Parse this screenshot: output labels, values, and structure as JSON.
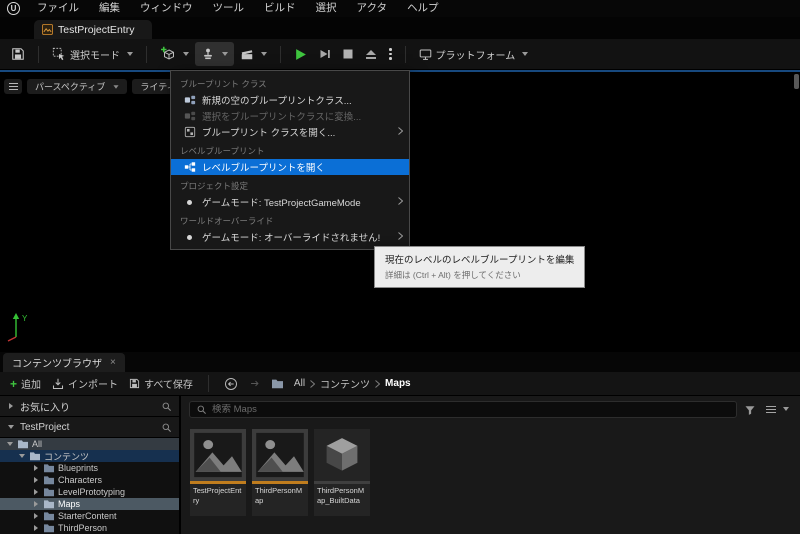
{
  "colors": {
    "accent_blue": "#0b6fd6",
    "accent_orange": "#c07d1e",
    "play_green": "#3fc43f",
    "selection_navy": "#16304f"
  },
  "menubar": {
    "items": [
      "ファイル",
      "編集",
      "ウィンドウ",
      "ツール",
      "ビルド",
      "選択",
      "アクタ",
      "ヘルプ"
    ]
  },
  "window_tab": {
    "label": "TestProjectEntry"
  },
  "toolbar": {
    "select_mode_label": "選択モード",
    "platform_label": "プラットフォーム"
  },
  "blueprint_menu": {
    "sections": [
      {
        "header": "ブループリント クラス",
        "items": [
          {
            "label": "新規の空のブループリントクラス...",
            "state": "normal",
            "submenu": false
          },
          {
            "label": "選択をブループリントクラスに変換...",
            "state": "disabled",
            "submenu": false
          },
          {
            "label": "ブループリント クラスを開く...",
            "state": "normal",
            "submenu": true
          }
        ]
      },
      {
        "header": "レベルブループリント",
        "items": [
          {
            "label": "レベルブループリントを開く",
            "state": "highlighted",
            "submenu": false
          }
        ]
      },
      {
        "header": "プロジェクト設定",
        "items": [
          {
            "label": "ゲームモード: TestProjectGameMode",
            "state": "normal",
            "submenu": true
          }
        ]
      },
      {
        "header": "ワールドオーバーライド",
        "items": [
          {
            "label": "ゲームモード: オーバーライドされません!",
            "state": "normal",
            "submenu": true
          }
        ]
      }
    ]
  },
  "viewport": {
    "perspective_label": "パースペクティブ",
    "lighting_label": "ライティングあり",
    "axis_y_label": "Y"
  },
  "tooltip": {
    "line1": "現在のレベルのレベルブループリントを編集",
    "line2": "詳細は (Ctrl + Alt) を押してください"
  },
  "content_browser": {
    "tab_label": "コンテンツブラウザ",
    "tab_close": "×",
    "toolbar": {
      "add_label": "追加",
      "import_label": "インポート",
      "save_all_label": "すべて保存"
    },
    "breadcrumb": {
      "items": [
        "All",
        "コンテンツ",
        "Maps"
      ]
    },
    "left_panel": {
      "favorites_label": "お気に入り",
      "project_label": "TestProject",
      "tree": [
        {
          "label": "All",
          "level": 0,
          "expanded": true,
          "state": "row-all"
        },
        {
          "label": "コンテンツ",
          "level": 1,
          "expanded": true,
          "state": "row-navy"
        },
        {
          "label": "Blueprints",
          "level": 2,
          "expanded": false,
          "state": "none"
        },
        {
          "label": "Characters",
          "level": 2,
          "expanded": false,
          "state": "none"
        },
        {
          "label": "LevelPrototyping",
          "level": 2,
          "expanded": false,
          "state": "none"
        },
        {
          "label": "Maps",
          "level": 2,
          "expanded": false,
          "state": "selected"
        },
        {
          "label": "StarterContent",
          "level": 2,
          "expanded": false,
          "state": "none"
        },
        {
          "label": "ThirdPerson",
          "level": 2,
          "expanded": false,
          "state": "none"
        }
      ]
    },
    "search": {
      "placeholder": "検索 Maps"
    },
    "assets": [
      {
        "name": "TestProjectEntry",
        "kind": "level"
      },
      {
        "name": "ThirdPersonMap",
        "kind": "level"
      },
      {
        "name": "ThirdPersonMap_BuiltData",
        "kind": "built-data"
      }
    ]
  }
}
